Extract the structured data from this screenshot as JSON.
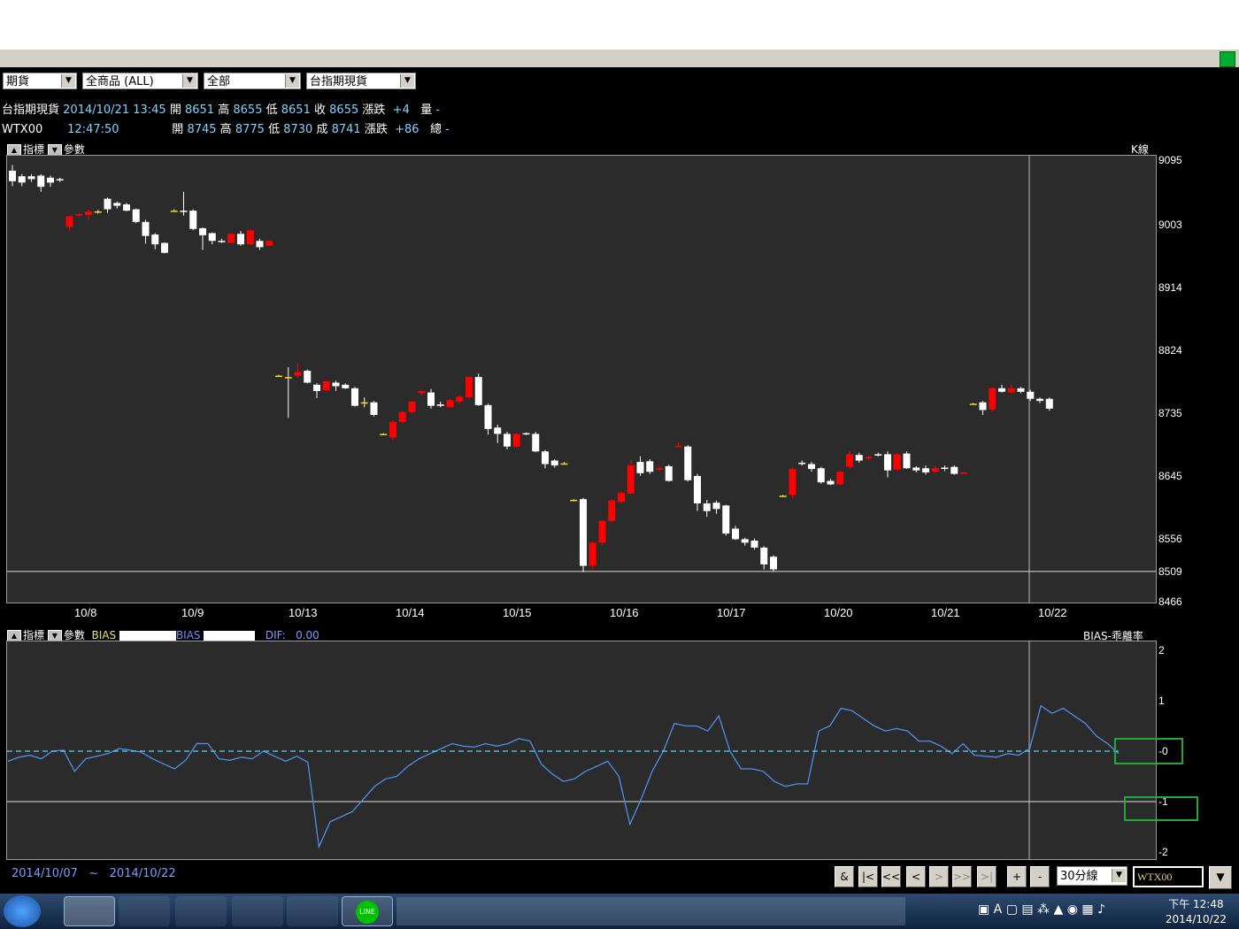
{
  "selectors": [
    {
      "label": "期貨"
    },
    {
      "label": "全商品      (ALL)"
    },
    {
      "label": "全部"
    },
    {
      "label": "台指期現貨"
    }
  ],
  "quote_rows": [
    {
      "name": "台指期現貨",
      "time": "2014/10/21 13:45",
      "open_label": "開",
      "open": "8651",
      "high_label": "高",
      "high": "8655",
      "low_label": "低",
      "low": "8651",
      "close_label": "收",
      "close": "8655",
      "chg_label": "漲跌",
      "chg": "+4",
      "vol_label": "量",
      "vol": "-"
    },
    {
      "name": "WTX00",
      "time": "12:47:50",
      "open_label": "開",
      "open": "8745",
      "high_label": "高",
      "high": "8775",
      "low_label": "低",
      "low": "8730",
      "close_label": "成",
      "close": "8741",
      "chg_label": "漲跌",
      "chg": "+86",
      "vol_label": "總",
      "vol": "-"
    }
  ],
  "main_tools": {
    "indicator": "指標",
    "params": "參數",
    "chart_kind": "K線"
  },
  "bias_tools": {
    "indicator": "指標",
    "params": "參數",
    "bias1": "BIAS",
    "bias2": "BIAS",
    "dif_label": "DIF:",
    "dif_value": "0.00",
    "title": "BIAS-乖離率"
  },
  "date_range": {
    "from": "2014/10/07",
    "tilde": "~",
    "to": "2014/10/22"
  },
  "nav": {
    "amp": "&",
    "first": "|<",
    "prev_page": "<<",
    "prev": "<",
    "next": ">",
    "next_page": ">>",
    "last": ">|",
    "plus": "+",
    "minus": "-",
    "interval": "30分線",
    "symbol": "WTX00"
  },
  "clock": {
    "ampm_time": "下午 12:48",
    "date": "2014/10/22"
  },
  "chart_data": [
    {
      "type": "candlestick",
      "title": "K線",
      "y_ticks": [
        9095,
        9003,
        8914,
        8824,
        8735,
        8645,
        8556,
        8509,
        8466
      ],
      "ylim": [
        8466,
        9095
      ],
      "reference_line": 8509,
      "x_ticks": [
        "10/8",
        "10/9",
        "10/13",
        "10/14",
        "10/15",
        "10/16",
        "10/17",
        "10/20",
        "10/21",
        "10/22"
      ],
      "up_color": "#ff0000",
      "down_color": "#ffffff",
      "candles": [
        [
          0,
          9080,
          9065,
          9088,
          9058
        ],
        [
          1,
          9072,
          9063,
          9075,
          9058
        ],
        [
          2,
          9072,
          9068,
          9075,
          9064
        ],
        [
          3,
          9073,
          9057,
          9075,
          9050
        ],
        [
          4,
          9070,
          9063,
          9073,
          9057
        ],
        [
          5,
          9068,
          9067,
          9070,
          9064
        ],
        [
          6,
          9000,
          9015,
          9016,
          8994
        ],
        [
          7,
          9016,
          9018,
          9020,
          9015
        ],
        [
          8,
          9017,
          9022,
          9024,
          9010
        ],
        [
          9,
          9022,
          9022,
          9024,
          9019
        ],
        [
          10,
          9040,
          9025,
          9042,
          9020
        ],
        [
          11,
          9034,
          9030,
          9036,
          9026
        ],
        [
          12,
          9032,
          9023,
          9034,
          9022
        ],
        [
          13,
          9025,
          9007,
          9026,
          9005
        ],
        [
          14,
          9007,
          8987,
          9010,
          8976
        ],
        [
          15,
          8989,
          8975,
          8991,
          8968
        ],
        [
          16,
          8977,
          8963,
          8978,
          8962
        ],
        [
          17,
          9023,
          9023,
          9025,
          9023
        ],
        [
          18,
          9023,
          9022,
          9050,
          9016
        ],
        [
          19,
          9023,
          8997,
          9025,
          8995
        ],
        [
          20,
          8998,
          8988,
          8999,
          8967
        ],
        [
          21,
          8991,
          8980,
          8992,
          8975
        ],
        [
          22,
          8980,
          8979,
          8983,
          8977
        ],
        [
          23,
          8977,
          8990,
          8991,
          8976
        ],
        [
          24,
          8990,
          8975,
          8994,
          8973
        ],
        [
          25,
          8975,
          8995,
          8997,
          8974
        ],
        [
          26,
          8980,
          8971,
          8983,
          8967
        ],
        [
          27,
          8973,
          8980,
          8981,
          8976
        ],
        [
          28,
          8788,
          8788,
          8789,
          8788
        ],
        [
          29,
          8786,
          8786,
          8800,
          8728
        ],
        [
          30,
          8788,
          8793,
          8806,
          8785
        ],
        [
          31,
          8795,
          8778,
          8797,
          8777
        ],
        [
          32,
          8775,
          8766,
          8777,
          8756
        ],
        [
          33,
          8767,
          8780,
          8781,
          8766
        ],
        [
          34,
          8778,
          8773,
          8781,
          8766
        ],
        [
          35,
          8775,
          8770,
          8777,
          8769
        ],
        [
          36,
          8770,
          8745,
          8772,
          8744
        ],
        [
          37,
          8750,
          8750,
          8757,
          8743
        ],
        [
          38,
          8750,
          8732,
          8752,
          8730
        ],
        [
          39,
          8705,
          8705,
          8706,
          8704
        ],
        [
          40,
          8700,
          8722,
          8724,
          8696
        ],
        [
          41,
          8722,
          8736,
          8738,
          8720
        ],
        [
          42,
          8736,
          8751,
          8752,
          8734
        ],
        [
          43,
          8763,
          8766,
          8768,
          8760
        ],
        [
          44,
          8764,
          8745,
          8769,
          8741
        ],
        [
          45,
          8747,
          8745,
          8751,
          8743
        ],
        [
          46,
          8743,
          8753,
          8755,
          8742
        ],
        [
          47,
          8751,
          8758,
          8760,
          8748
        ],
        [
          48,
          8757,
          8786,
          8787,
          8755
        ],
        [
          49,
          8786,
          8746,
          8791,
          8745
        ],
        [
          50,
          8746,
          8712,
          8748,
          8704
        ],
        [
          51,
          8714,
          8705,
          8718,
          8692
        ],
        [
          52,
          8705,
          8687,
          8708,
          8683
        ],
        [
          53,
          8687,
          8705,
          8706,
          8685
        ],
        [
          54,
          8706,
          8705,
          8707,
          8703
        ],
        [
          55,
          8705,
          8680,
          8708,
          8679
        ],
        [
          56,
          8680,
          8662,
          8682,
          8656
        ],
        [
          57,
          8667,
          8660,
          8669,
          8657
        ],
        [
          58,
          8663,
          8663,
          8665,
          8662
        ],
        [
          59,
          8611,
          8611,
          8612,
          8610
        ],
        [
          60,
          8612,
          8517,
          8614,
          8508
        ],
        [
          61,
          8517,
          8550,
          8552,
          8512
        ],
        [
          62,
          8550,
          8581,
          8582,
          8547
        ],
        [
          63,
          8581,
          8610,
          8612,
          8578
        ],
        [
          64,
          8608,
          8621,
          8623,
          8606
        ],
        [
          65,
          8620,
          8660,
          8668,
          8618
        ],
        [
          66,
          8665,
          8649,
          8673,
          8645
        ],
        [
          67,
          8666,
          8651,
          8669,
          8648
        ],
        [
          68,
          8655,
          8656,
          8660,
          8652
        ],
        [
          69,
          8659,
          8638,
          8661,
          8637
        ],
        [
          70,
          8687,
          8688,
          8693,
          8686
        ],
        [
          71,
          8687,
          8639,
          8689,
          8637
        ],
        [
          72,
          8645,
          8606,
          8648,
          8595
        ],
        [
          73,
          8606,
          8595,
          8611,
          8587
        ],
        [
          74,
          8607,
          8598,
          8610,
          8591
        ],
        [
          75,
          8603,
          8563,
          8604,
          8560
        ],
        [
          76,
          8570,
          8555,
          8574,
          8554
        ],
        [
          77,
          8555,
          8550,
          8557,
          8546
        ],
        [
          78,
          8553,
          8543,
          8556,
          8540
        ],
        [
          79,
          8543,
          8519,
          8545,
          8512
        ],
        [
          80,
          8530,
          8512,
          8532,
          8509
        ],
        [
          81,
          8617,
          8617,
          8618,
          8616
        ],
        [
          82,
          8618,
          8655,
          8657,
          8613
        ],
        [
          83,
          8664,
          8662,
          8667,
          8660
        ],
        [
          84,
          8662,
          8655,
          8665,
          8651
        ],
        [
          85,
          8656,
          8636,
          8658,
          8634
        ],
        [
          86,
          8638,
          8633,
          8641,
          8632
        ],
        [
          87,
          8633,
          8651,
          8653,
          8632
        ],
        [
          88,
          8658,
          8676,
          8680,
          8655
        ],
        [
          89,
          8675,
          8667,
          8678,
          8664
        ],
        [
          90,
          8670,
          8672,
          8674,
          8668
        ],
        [
          91,
          8676,
          8675,
          8678,
          8673
        ],
        [
          92,
          8676,
          8653,
          8680,
          8643
        ],
        [
          93,
          8654,
          8676,
          8678,
          8652
        ],
        [
          94,
          8677,
          8656,
          8680,
          8655
        ],
        [
          95,
          8657,
          8653,
          8659,
          8650
        ],
        [
          96,
          8656,
          8650,
          8660,
          8647
        ],
        [
          97,
          8651,
          8656,
          8659,
          8650
        ],
        [
          98,
          8657,
          8655,
          8660,
          8652
        ],
        [
          99,
          8658,
          8648,
          8660,
          8647
        ],
        [
          100,
          8649,
          8650,
          8652,
          8647
        ],
        [
          101,
          8748,
          8748,
          8749,
          8747
        ],
        [
          102,
          8750,
          8739,
          8752,
          8732
        ],
        [
          103,
          8740,
          8770,
          8772,
          8737
        ],
        [
          104,
          8770,
          8765,
          8775,
          8764
        ],
        [
          105,
          8764,
          8770,
          8776,
          8762
        ],
        [
          106,
          8770,
          8765,
          8772,
          8763
        ],
        [
          107,
          8765,
          8755,
          8768,
          8752
        ],
        [
          108,
          8755,
          8752,
          8757,
          8749
        ],
        [
          109,
          8755,
          8741,
          8757,
          8738
        ]
      ]
    },
    {
      "type": "line",
      "title": "BIAS-乖離率",
      "y_ticks": [
        2,
        1,
        0,
        -1,
        -2
      ],
      "ylim": [
        -2,
        2
      ],
      "reference_line": -1,
      "series": [
        {
          "name": "BIAS",
          "color": "#4f8fe8",
          "values": [
            -0.2,
            -0.12,
            -0.08,
            -0.15,
            0.0,
            0.02,
            -0.4,
            -0.15,
            -0.1,
            -0.05,
            0.05,
            0.02,
            -0.02,
            -0.15,
            -0.25,
            -0.35,
            -0.18,
            0.15,
            0.15,
            -0.15,
            -0.18,
            -0.12,
            -0.15,
            0.0,
            -0.1,
            -0.2,
            -0.1,
            -0.22,
            -1.9,
            -1.4,
            -1.3,
            -1.2,
            -0.95,
            -0.7,
            -0.55,
            -0.5,
            -0.3,
            -0.15,
            -0.05,
            0.05,
            0.15,
            0.1,
            0.08,
            0.15,
            0.1,
            0.15,
            0.25,
            0.2,
            -0.25,
            -0.45,
            -0.6,
            -0.55,
            -0.4,
            -0.3,
            -0.2,
            -0.5,
            -1.45,
            -0.95,
            -0.4,
            0.0,
            0.55,
            0.5,
            0.5,
            0.4,
            0.7,
            0.0,
            -0.35,
            -0.35,
            -0.4,
            -0.6,
            -0.7,
            -0.65,
            -0.65,
            0.4,
            0.5,
            0.85,
            0.8,
            0.65,
            0.5,
            0.4,
            0.45,
            0.4,
            0.2,
            0.2,
            0.1,
            -0.05,
            0.15,
            -0.08,
            -0.1,
            -0.12,
            -0.05,
            -0.08,
            0.05,
            0.9,
            0.75,
            0.85,
            0.7,
            0.55,
            0.3,
            0.15,
            -0.05
          ]
        },
        {
          "name": "BIAS",
          "color": "#5ad3f0",
          "dashed": true,
          "values": [
            0.0
          ]
        }
      ]
    }
  ]
}
